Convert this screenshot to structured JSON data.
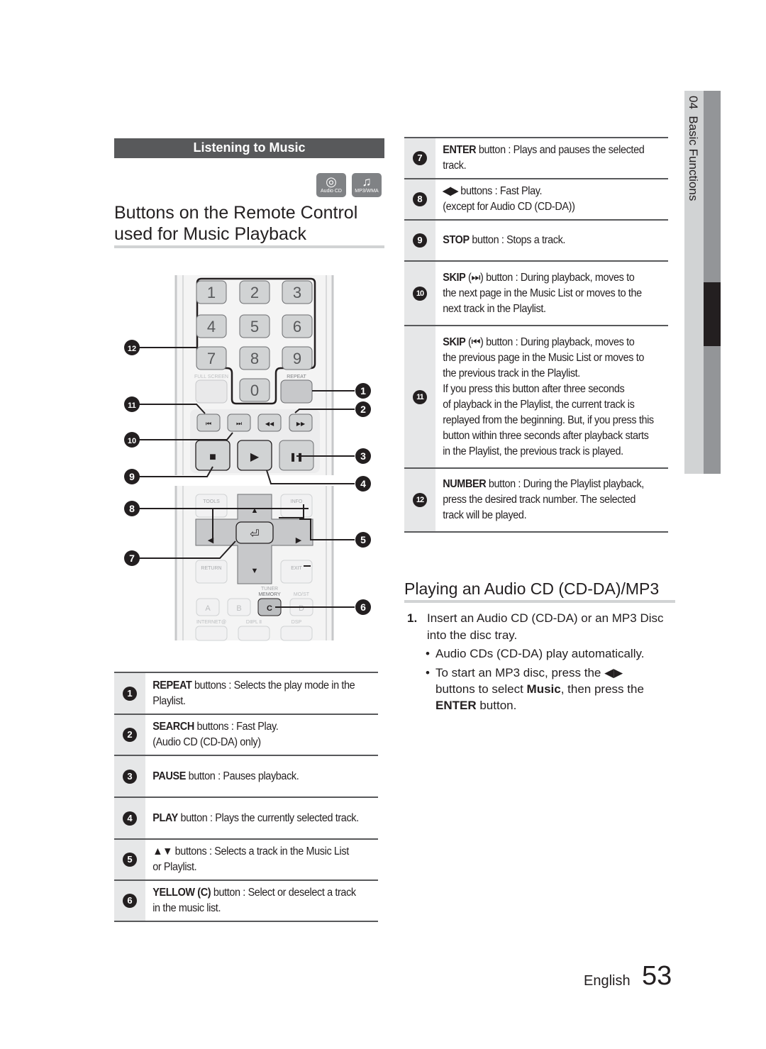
{
  "section_header": "Listening to Music",
  "badges": [
    {
      "icon": "disc-icon",
      "glyph": "◎",
      "label": "Audio CD"
    },
    {
      "icon": "music-note-icon",
      "glyph": "♫",
      "label": "MP3/WMA"
    }
  ],
  "main_title_line1": "Buttons on the Remote Control",
  "main_title_line2": "used for Music Playback",
  "remote": {
    "number_keys": [
      "1",
      "2",
      "3",
      "4",
      "5",
      "6",
      "7",
      "8",
      "9",
      "0"
    ],
    "labels": {
      "full_screen": "FULL SCREEN",
      "repeat": "REPEAT",
      "tools": "TOOLS",
      "info": "INFO",
      "return": "RETURN",
      "exit": "EXIT",
      "tuner_memory_1": "TUNER",
      "tuner_memory_2": "MEMORY",
      "mo_st": "MO/ST",
      "internet": "INTERNET@",
      "dpl": "DⅡPL Ⅱ",
      "dsp": "DSP"
    },
    "color_keys": [
      "A",
      "B",
      "C",
      "D"
    ],
    "transport": {
      "prev": "⏮",
      "next": "⏭",
      "rew": "◀◀",
      "ff": "▶▶",
      "stop": "■",
      "play": "▶",
      "pause": "❚❚"
    },
    "nav": {
      "up": "▲",
      "down": "▼",
      "left": "◀",
      "right": "▶",
      "enter": "⏎"
    },
    "callouts": [
      "1",
      "2",
      "3",
      "4",
      "5",
      "6",
      "7",
      "8",
      "9",
      "10",
      "11",
      "12"
    ]
  },
  "left_table": [
    {
      "num": "1",
      "bold": "REPEAT",
      "rest": " buttons : Selects the play mode in the",
      "line2": "Playlist."
    },
    {
      "num": "2",
      "bold": "SEARCH",
      "rest": " buttons : Fast Play.",
      "line2": "(Audio CD (CD-DA) only)"
    },
    {
      "num": "3",
      "bold": "PAUSE",
      "rest": " button : Pauses playback.",
      "line2": ""
    },
    {
      "num": "4",
      "bold": "PLAY",
      "rest": " button : Plays the currently selected track.",
      "line2": ""
    },
    {
      "num": "5",
      "bold": "▲▼",
      "rest": " buttons : Selects a track in the Music List",
      "line2": "or Playlist."
    },
    {
      "num": "6",
      "bold": "YELLOW (C)",
      "rest": " button : Select or deselect a track",
      "line2": "in the music list."
    }
  ],
  "right_table": [
    {
      "num": "7",
      "bold": "ENTER",
      "rest": " button : Plays and pauses the selected",
      "lines": [
        "track."
      ]
    },
    {
      "num": "8",
      "bold": "◀▶",
      "rest": " buttons : Fast Play.",
      "lines": [
        "(except for Audio CD (CD-DA))"
      ]
    },
    {
      "num": "9",
      "bold": "STOP",
      "rest": " button : Stops a track.",
      "lines": []
    },
    {
      "num": "10",
      "bold": "SKIP",
      "rest": " (⏭) button : During playback, moves to",
      "lines": [
        "the next page in the Music List or moves to the",
        "next track in the Playlist."
      ]
    },
    {
      "num": "11",
      "bold": "SKIP",
      "rest": " (⏮) button : During playback, moves to",
      "lines": [
        "the previous page in the Music List or moves to",
        "the previous track in the Playlist.",
        "If you press this button after three seconds",
        "of playback in the Playlist, the current track is",
        "replayed from the beginning. But, if you press this",
        "button within three seconds after playback starts",
        "in the Playlist, the previous track is played."
      ]
    },
    {
      "num": "12",
      "bold": "NUMBER",
      "rest": " button : During the Playlist playback,",
      "lines": [
        "press the desired track number. The selected",
        "track will be played."
      ]
    }
  ],
  "subtitle": "Playing an Audio CD (CD-DA)/MP3",
  "steps": {
    "step1_num": "1.",
    "step1_line1": "Insert an Audio CD (CD-DA) or an MP3 Disc",
    "step1_line2": "into the disc tray.",
    "bullet1": "Audio CDs (CD-DA) play automatically.",
    "bullet2_line1": "To start an MP3 disc, press the ◀▶",
    "bullet2_line2_pre": "buttons to select ",
    "bullet2_line2_bold": "Music",
    "bullet2_line2_post": ", then press the",
    "bullet2_line3_bold": "ENTER",
    "bullet2_line3_post": " button."
  },
  "side_tab": {
    "chapter": "04",
    "title": "Basic Functions"
  },
  "footer": {
    "language": "English",
    "page": "53"
  }
}
